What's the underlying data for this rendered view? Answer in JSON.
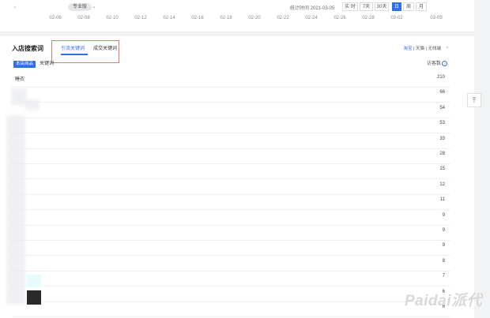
{
  "header": {
    "edition_label": "专业版",
    "stat_time": "统计时间 2021-03-05",
    "time_ranges": [
      {
        "label": "实 时",
        "active": false
      },
      {
        "label": "7天",
        "active": false
      },
      {
        "label": "30天",
        "active": false
      },
      {
        "label": "日",
        "active": true
      },
      {
        "label": "周",
        "active": false
      },
      {
        "label": "月",
        "active": false
      }
    ],
    "x_ticks": [
      "02-06",
      "02-08",
      "02-10",
      "02-12",
      "02-14",
      "02-16",
      "02-18",
      "02-20",
      "02-22",
      "02-24",
      "02-26",
      "02-28",
      "03-02",
      "03-05"
    ]
  },
  "section": {
    "title": "入店搜索词",
    "tabs": [
      {
        "label": "引流关键词",
        "active": true
      },
      {
        "label": "成交关键词",
        "active": false
      }
    ],
    "platform_links": [
      "淘宝",
      "天猫"
    ],
    "device_select": "无线端"
  },
  "table": {
    "badge": "本店商品",
    "keyword_header": "关键词",
    "visitor_header": "访客数",
    "accent_color": "#2f6fe9",
    "rows": [
      {
        "keyword": "睡衣",
        "value": "210"
      },
      {
        "keyword": "",
        "value": "66"
      },
      {
        "keyword": "",
        "value": "54"
      },
      {
        "keyword": "",
        "value": "53"
      },
      {
        "keyword": "",
        "value": "33"
      },
      {
        "keyword": "",
        "value": "28"
      },
      {
        "keyword": "",
        "value": "15"
      },
      {
        "keyword": "",
        "value": "12"
      },
      {
        "keyword": "",
        "value": "11"
      },
      {
        "keyword": "",
        "value": "9"
      },
      {
        "keyword": "",
        "value": "9"
      },
      {
        "keyword": "",
        "value": "9"
      },
      {
        "keyword": "",
        "value": "8"
      },
      {
        "keyword": "",
        "value": "7"
      },
      {
        "keyword": "",
        "value": "6"
      },
      {
        "keyword": "",
        "value": "6"
      }
    ]
  },
  "watermark": "Paidai派代",
  "back_to_top_glyph": "⤒"
}
